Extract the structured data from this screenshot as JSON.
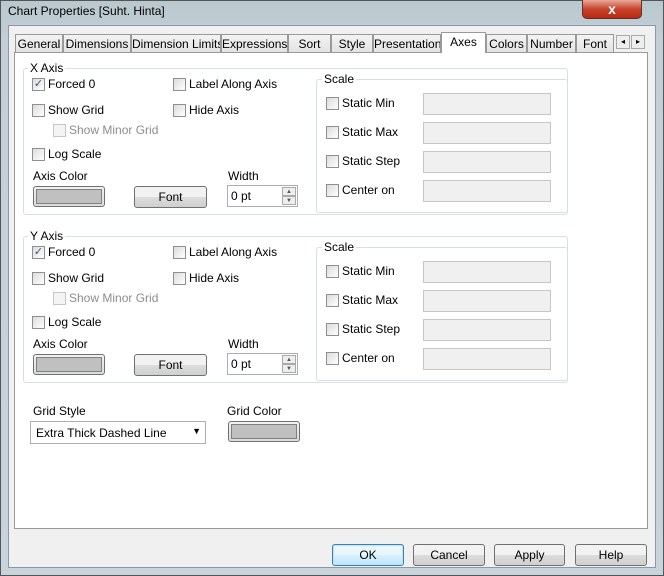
{
  "window": {
    "title": "Chart Properties [Suht. Hinta]",
    "close_label": "x"
  },
  "tabs": [
    "General",
    "Dimensions",
    "Dimension Limits",
    "Expressions",
    "Sort",
    "Style",
    "Presentation",
    "Axes",
    "Colors",
    "Number",
    "Font"
  ],
  "selected_tab": "Axes",
  "tab_scroll": {
    "left": "◂",
    "right": "▸"
  },
  "x_axis": {
    "title": "X Axis",
    "forced0": "Forced 0",
    "forced0_checked": true,
    "label_along": "Label Along Axis",
    "show_grid": "Show Grid",
    "hide_axis": "Hide Axis",
    "show_minor_grid": "Show Minor Grid",
    "log_scale": "Log Scale",
    "axis_color": "Axis Color",
    "font_button": "Font",
    "width_label": "Width",
    "width_value": "0 pt",
    "scale": {
      "title": "Scale",
      "static_min": "Static Min",
      "static_max": "Static Max",
      "static_step": "Static Step",
      "center_on": "Center on"
    }
  },
  "y_axis": {
    "title": "Y Axis",
    "forced0": "Forced 0",
    "forced0_checked": true,
    "label_along": "Label Along Axis",
    "show_grid": "Show Grid",
    "hide_axis": "Hide Axis",
    "show_minor_grid": "Show Minor Grid",
    "log_scale": "Log Scale",
    "axis_color": "Axis Color",
    "font_button": "Font",
    "width_label": "Width",
    "width_value": "0 pt",
    "scale": {
      "title": "Scale",
      "static_min": "Static Min",
      "static_max": "Static Max",
      "static_step": "Static Step",
      "center_on": "Center on"
    }
  },
  "grid": {
    "style_label": "Grid Style",
    "style_value": "Extra Thick Dashed Line",
    "color_label": "Grid Color"
  },
  "colors": {
    "axis_color": "#c0c0c0",
    "grid_color": "#c0c0c0"
  },
  "buttons": {
    "ok": "OK",
    "cancel": "Cancel",
    "apply": "Apply",
    "help": "Help"
  }
}
